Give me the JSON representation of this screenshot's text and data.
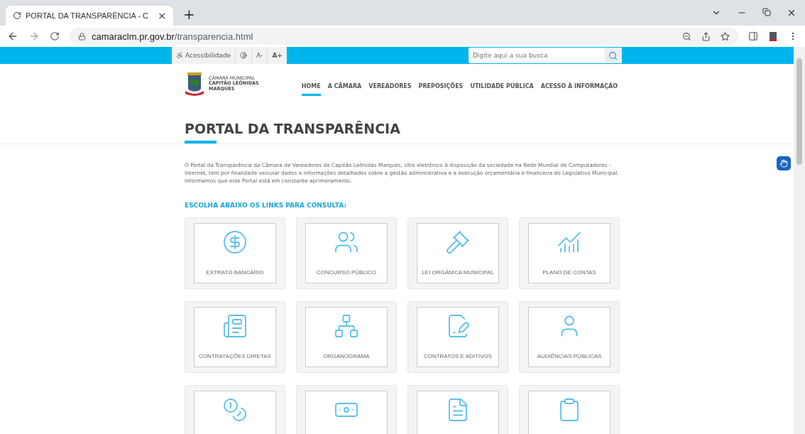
{
  "browser": {
    "tab_title": "PORTAL DA TRANSPARÊNCIA - C",
    "tab_close": "×",
    "new_tab": "+",
    "url_host": "camaraclm.pr.gov.br",
    "url_path": "/transparencia.html"
  },
  "accessibility_bar": {
    "label": "Acessibilidade",
    "font_smaller": "A-",
    "font_larger": "A+"
  },
  "search": {
    "placeholder": "Digite aqui a sua busca"
  },
  "logo": {
    "line1": "CÂMARA MUNICIPAL",
    "line2": "CAPITÃO LEÔNIDAS",
    "line3": "MARQUES"
  },
  "nav": [
    {
      "label": "HOME",
      "selected": true
    },
    {
      "label": "A CÂMARA",
      "selected": false
    },
    {
      "label": "VEREADORES",
      "selected": false
    },
    {
      "label": "PREPOSIÇÕES",
      "selected": false
    },
    {
      "label": "UTILIDADE PÚBLICA",
      "selected": false
    },
    {
      "label": "ACESSO À INFORMAÇÃO",
      "selected": false
    }
  ],
  "page_title": "PORTAL DA TRANSPARÊNCIA",
  "intro": [
    "O Portal da Transparência da Câmara de Vereadores de Capitão Leônidas Marques, sítio eletrônico à disposição da sociedade na Rede Mundial de Computadores – Internet, tem por finalidade veicular dados e informações detalhados sobre a gestão administrativa e a execução orçamentária e financeira do Legislativo Municipal.",
    "Informamos que este Portal está em constante aprimoramento."
  ],
  "links_heading": "ESCOLHA ABAIXO OS LINKS PARA CONSULTA:",
  "links": [
    {
      "kind": "labeled",
      "label": "EXTRATO BANCÁRIO"
    },
    {
      "kind": "labeled",
      "label": "CONCURSO PÚBLICO"
    },
    {
      "kind": "labeled",
      "label": "LEI ORGÂNICA MUNICIPAL"
    },
    {
      "kind": "labeled",
      "label": "PLANO DE CONTAS"
    },
    {
      "kind": "labeled",
      "label": "CONTRATAÇÕES DIRETAS"
    },
    {
      "kind": "labeled",
      "label": "ORGANOGRAMA"
    },
    {
      "kind": "labeled",
      "label": "CONTRATOS E ADITIVOS"
    },
    {
      "kind": "labeled",
      "label": "AUDIÊNCIAS PÚBLICAS"
    },
    {
      "kind": "icon"
    },
    {
      "kind": "icon"
    },
    {
      "kind": "icon"
    },
    {
      "kind": "icon"
    }
  ]
}
